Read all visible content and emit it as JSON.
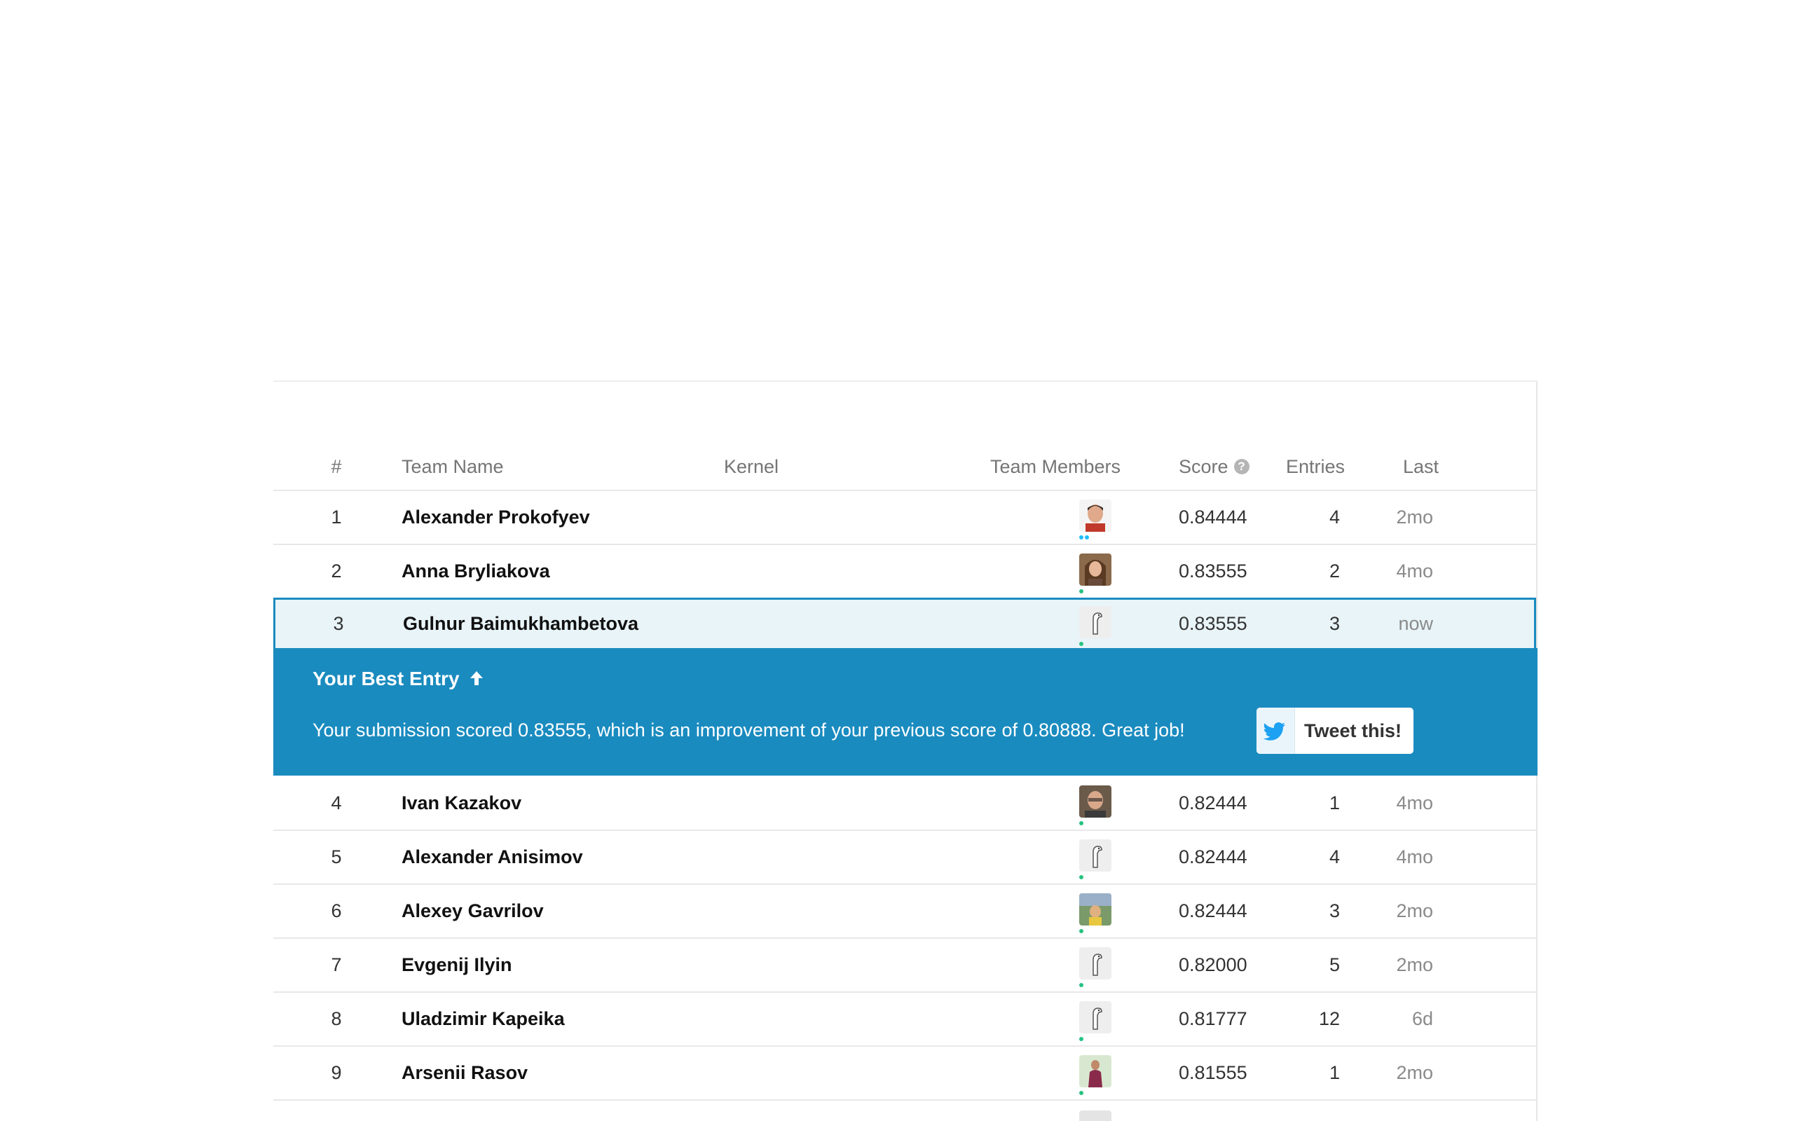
{
  "leaderboard": {
    "headers": {
      "rank": "#",
      "team_name": "Team Name",
      "kernel": "Kernel",
      "team_members": "Team Members",
      "score": "Score",
      "entries": "Entries",
      "last": "Last"
    },
    "rows": [
      {
        "rank": "1",
        "name": "Alexander Prokofyev",
        "score": "0.84444",
        "entries": "4",
        "last": "2mo",
        "avatar": "photo-man-icon"
      },
      {
        "rank": "2",
        "name": "Anna Bryliakova",
        "score": "0.83555",
        "entries": "2",
        "last": "4mo",
        "avatar": "photo-woman-icon"
      },
      {
        "rank": "3",
        "name": "Gulnur Baimukhambetova",
        "score": "0.83555",
        "entries": "3",
        "last": "now",
        "avatar": "goose-icon"
      },
      {
        "rank": "4",
        "name": "Ivan Kazakov",
        "score": "0.82444",
        "entries": "1",
        "last": "4mo",
        "avatar": "photo-man-icon"
      },
      {
        "rank": "5",
        "name": "Alexander Anisimov",
        "score": "0.82444",
        "entries": "4",
        "last": "4mo",
        "avatar": "goose-icon"
      },
      {
        "rank": "6",
        "name": "Alexey Gavrilov",
        "score": "0.82444",
        "entries": "3",
        "last": "2mo",
        "avatar": "photo-outdoor-icon"
      },
      {
        "rank": "7",
        "name": "Evgenij Ilyin",
        "score": "0.82000",
        "entries": "5",
        "last": "2mo",
        "avatar": "goose-icon"
      },
      {
        "rank": "8",
        "name": "Uladzimir Kapeika",
        "score": "0.81777",
        "entries": "12",
        "last": "6d",
        "avatar": "goose-icon"
      },
      {
        "rank": "9",
        "name": "Arsenii Rasov",
        "score": "0.81555",
        "entries": "1",
        "last": "2mo",
        "avatar": "photo-person-icon"
      }
    ]
  },
  "best_entry": {
    "title": "Your Best Entry",
    "message": "Your submission scored 0.83555, which is an improvement of your previous score of 0.80888. Great job!",
    "tweet_label": "Tweet this!"
  },
  "colors": {
    "accent": "#1a8bbf",
    "highlight_row": "#e8f4f8",
    "tier_blue": "#20beff",
    "tier_green": "#26c281"
  }
}
